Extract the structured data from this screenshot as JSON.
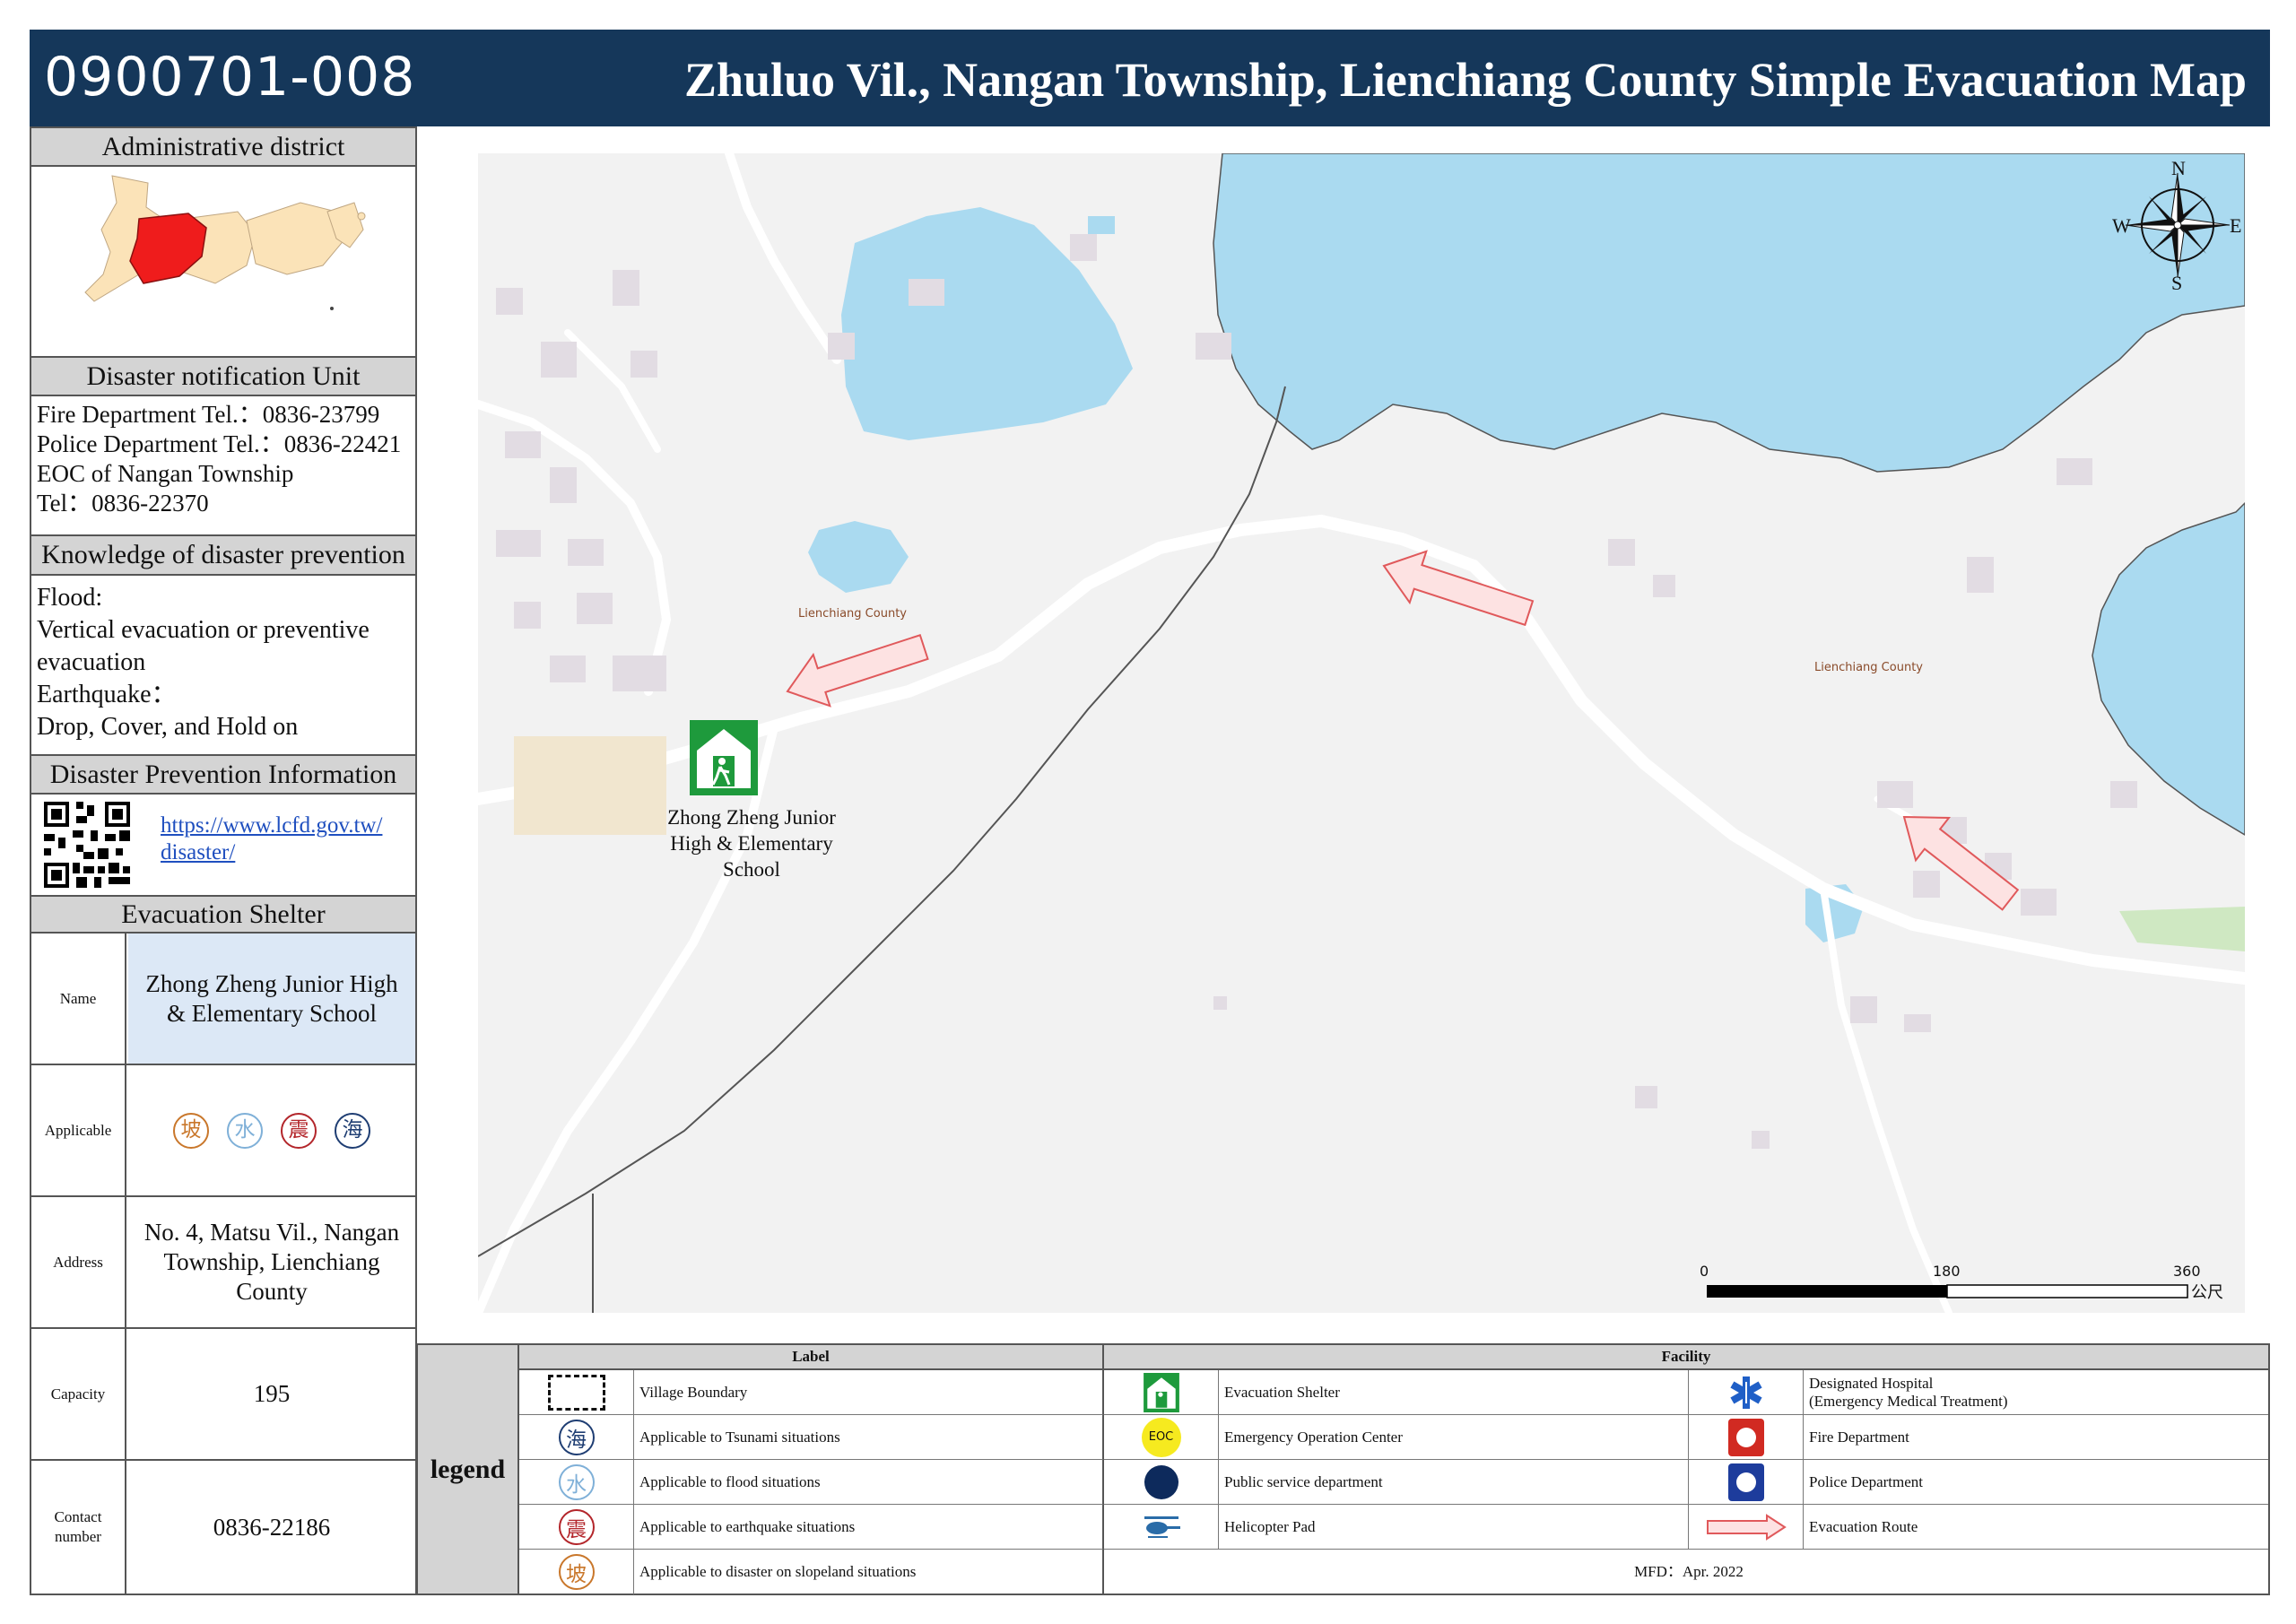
{
  "header": {
    "code": "0900701-008",
    "title": "Zhuluo Vil., Nangan Township, Lienchiang County Simple Evacuation Map"
  },
  "admin_district": {
    "heading": "Administrative district"
  },
  "notification": {
    "heading": "Disaster notification Unit",
    "lines": [
      "Fire Department Tel.：0836-23799",
      "Police Department Tel.：0836-22421",
      "EOC of Nangan Township",
      "Tel：0836-22370"
    ]
  },
  "knowledge": {
    "heading": "Knowledge of disaster prevention",
    "lines": [
      "Flood:",
      "Vertical evacuation or preventive evacuation",
      "Earthquake：",
      "Drop, Cover, and Hold on"
    ]
  },
  "prevention_info": {
    "heading": "Disaster Prevention Information",
    "link_line1": "https://www.lcfd.gov.tw/",
    "link_line2": "disaster/"
  },
  "shelter": {
    "heading": "Evacuation Shelter",
    "name_label": "Name",
    "name_value": "Zhong Zheng Junior High & Elementary School",
    "applicable_label": "Applicable",
    "badges": [
      {
        "char": "坡",
        "color": "#c9772b"
      },
      {
        "char": "水",
        "color": "#7fb0d8"
      },
      {
        "char": "震",
        "color": "#b3262b"
      },
      {
        "char": "海",
        "color": "#1f3e73"
      }
    ],
    "address_label": "Address",
    "address_value": "No. 4, Matsu Vil., Nangan Township, Lienchiang County",
    "capacity_label": "Capacity",
    "capacity_value": "195",
    "contact_label": "Contact number",
    "contact_value": "0836-22186"
  },
  "map": {
    "shelter_label_line1": "Zhong Zheng Junior",
    "shelter_label_line2": "High & Elementary School",
    "county_label_1": "Lienchiang County",
    "county_label_2": "Lienchiang County",
    "compass": {
      "n": "N",
      "s": "S",
      "e": "E",
      "w": "W"
    },
    "scale": {
      "v0": "0",
      "v1": "180",
      "v2": "360",
      "unit": "公尺"
    }
  },
  "legend": {
    "side_label": "legend",
    "label_heading": "Label",
    "facility_heading": "Facility",
    "labels": [
      "Village Boundary",
      "Applicable to Tsunami situations",
      "Applicable to flood situations",
      "Applicable to earthquake situations",
      "Applicable to disaster on slopeland situations"
    ],
    "facilities_left": [
      "Evacuation Shelter",
      "Emergency Operation Center",
      "Public service department",
      "Helicopter Pad"
    ],
    "facilities_right": [
      "Designated Hospital",
      "(Emergency Medical Treatment)",
      "Fire Department",
      "Police Department",
      "Evacuation Route"
    ],
    "eoc_text": "EOC",
    "mfd": "MFD：Apr. 2022"
  },
  "colors": {
    "header_bg": "#15375a",
    "water": "#aadaf0",
    "shelter_green": "#1e9a3c",
    "route_red": "#e0595b",
    "highlight_district": "#ef1c1c",
    "district_fill": "#fbe3b8"
  }
}
